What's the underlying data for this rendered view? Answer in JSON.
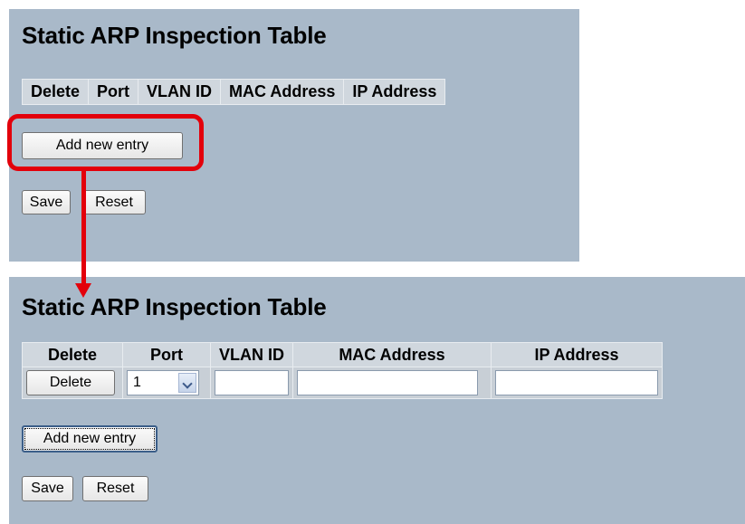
{
  "top": {
    "title": "Static ARP Inspection Table",
    "columns": [
      "Delete",
      "Port",
      "VLAN ID",
      "MAC Address",
      "IP Address"
    ],
    "add_label": "Add new entry",
    "save_label": "Save",
    "reset_label": "Reset"
  },
  "bottom": {
    "title": "Static ARP Inspection Table",
    "columns": [
      "Delete",
      "Port",
      "VLAN ID",
      "MAC Address",
      "IP Address"
    ],
    "row": {
      "delete_label": "Delete",
      "port_value": "1",
      "vlan_value": "",
      "mac_value": "",
      "ip_value": ""
    },
    "add_label": "Add new entry",
    "save_label": "Save",
    "reset_label": "Reset"
  },
  "colors": {
    "panel_bg": "#a9b9c9",
    "callout": "#e3000b"
  },
  "icons": {
    "port_select_arrow": "chevron-down-icon"
  }
}
